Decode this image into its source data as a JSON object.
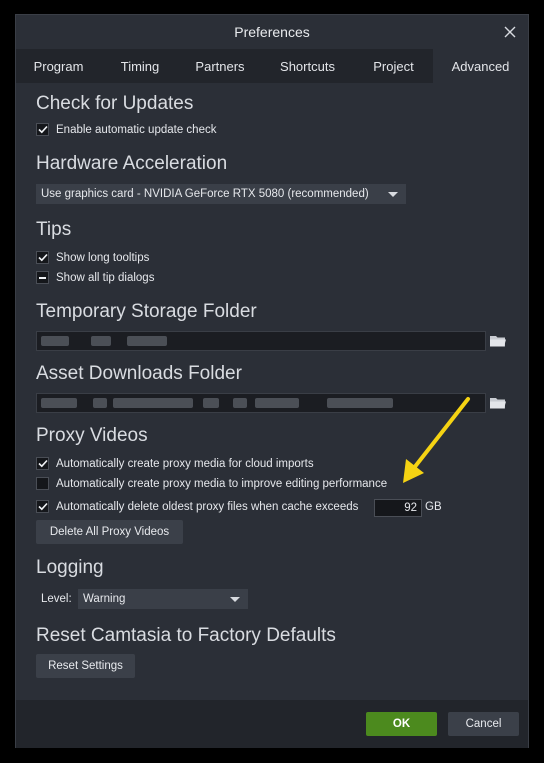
{
  "window": {
    "title": "Preferences"
  },
  "tabs": [
    {
      "label": "Program"
    },
    {
      "label": "Timing"
    },
    {
      "label": "Partners"
    },
    {
      "label": "Shortcuts"
    },
    {
      "label": "Project"
    },
    {
      "label": "Advanced",
      "active": true
    }
  ],
  "check_updates": {
    "title": "Check for Updates",
    "enable_label": "Enable automatic update check",
    "enable_checked": true
  },
  "hardware": {
    "title": "Hardware Acceleration",
    "selected": "Use graphics card - NVIDIA GeForce RTX 5080 (recommended)"
  },
  "tips": {
    "title": "Tips",
    "long_tooltips_label": "Show long tooltips",
    "long_tooltips_state": "checked",
    "all_tip_dialogs_label": "Show all tip dialogs",
    "all_tip_dialogs_state": "indeterminate"
  },
  "temp_storage": {
    "title": "Temporary Storage Folder"
  },
  "asset_downloads": {
    "title": "Asset Downloads Folder"
  },
  "proxy": {
    "title": "Proxy Videos",
    "cloud_label": "Automatically create proxy media for cloud imports",
    "cloud_checked": true,
    "improve_label": "Automatically create proxy media to improve editing performance",
    "improve_checked": false,
    "delete_label": "Automatically delete oldest proxy files when cache exceeds",
    "delete_checked": true,
    "cache_value": "92",
    "cache_unit": "GB",
    "delete_all_button": "Delete All Proxy Videos"
  },
  "logging": {
    "title": "Logging",
    "level_label": "Level:",
    "level_value": "Warning"
  },
  "reset": {
    "title": "Reset Camtasia to Factory Defaults",
    "button": "Reset Settings"
  },
  "footer": {
    "ok": "OK",
    "cancel": "Cancel"
  },
  "colors": {
    "accent_ok": "#4c8a1e",
    "annotation_arrow": "#f5d313",
    "background": "#2b2f37"
  }
}
